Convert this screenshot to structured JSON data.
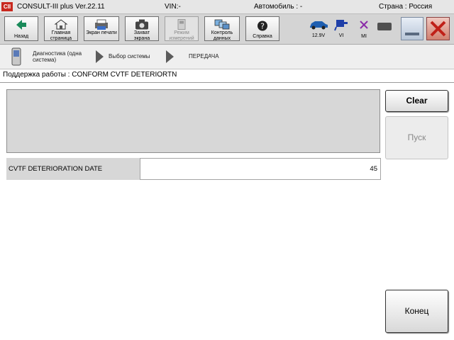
{
  "titlebar": {
    "logo": "CII",
    "app": "CONSULT-III plus  Ver.22.11",
    "vin": "VIN:-",
    "vehicle": "Автомобиль : -",
    "country": "Страна : Россия"
  },
  "toolbar": {
    "back": "Назад",
    "home": "Главная страница",
    "print": "Экран печати",
    "capture": "Захват экрана",
    "measure": "Режим измерений",
    "data": "Контроль данных",
    "help": "Справка"
  },
  "status": {
    "voltage": "12.9V",
    "vi": "VI",
    "mi": "MI"
  },
  "breadcrumb": {
    "step1": "Диагностика (одна система)",
    "step2": "Выбор системы",
    "step3": "ПЕРЕДАЧА"
  },
  "support_line": "Поддержка работы : CONFORM CVTF DETERIORTN",
  "data_row": {
    "label": "CVTF DETERIORATION DATE",
    "value": "45"
  },
  "buttons": {
    "clear": "Clear",
    "start": "Пуск",
    "end": "Конец"
  }
}
